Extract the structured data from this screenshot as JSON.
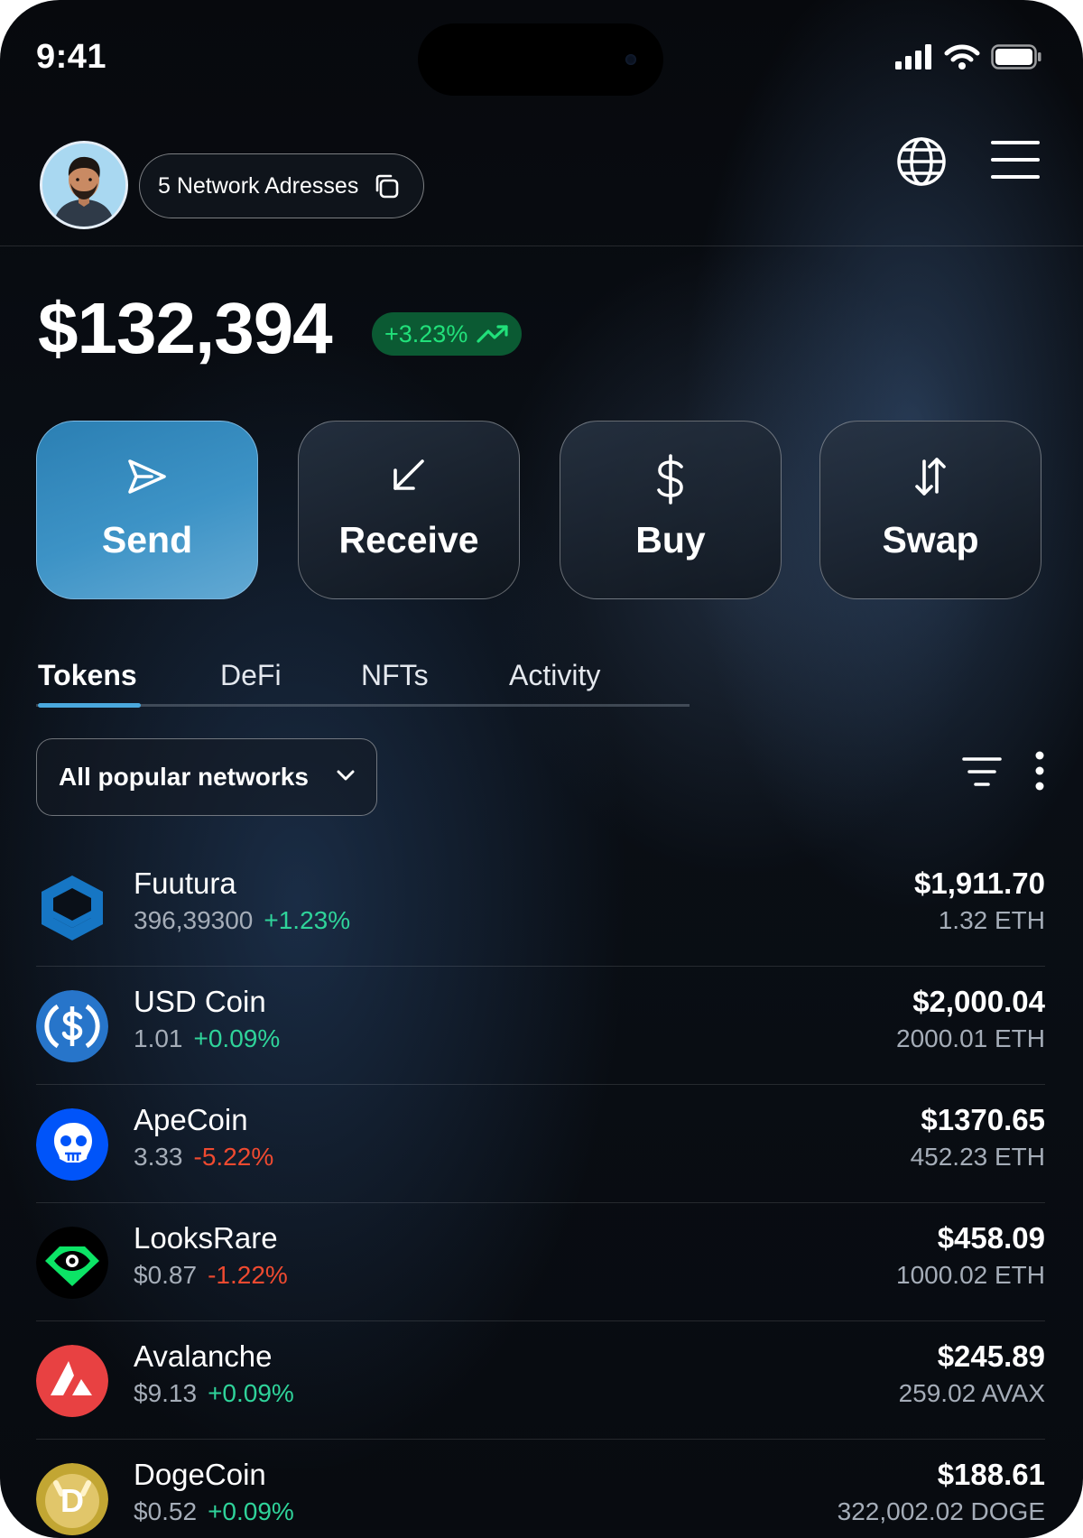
{
  "status_bar": {
    "time": "9:41"
  },
  "header": {
    "address_pill_label": "5 Network Adresses"
  },
  "balance": {
    "total": "$132,394",
    "change": "+3.23%"
  },
  "actions": [
    {
      "label": "Send",
      "icon": "send-icon"
    },
    {
      "label": "Receive",
      "icon": "arrow-down-left-icon"
    },
    {
      "label": "Buy",
      "icon": "dollar-icon"
    },
    {
      "label": "Swap",
      "icon": "swap-icon"
    }
  ],
  "tabs": [
    {
      "label": "Tokens",
      "active": true
    },
    {
      "label": "DeFi",
      "active": false
    },
    {
      "label": "NFTs",
      "active": false
    },
    {
      "label": "Activity",
      "active": false
    }
  ],
  "filter": {
    "network_select_value": "All popular networks"
  },
  "tokens": [
    {
      "name": "Fuutura",
      "price": "396,39300",
      "change": "+1.23%",
      "direction": "up",
      "value": "$1,911.70",
      "amount": "1.32 ETH",
      "icon": "fuutura-logo-icon",
      "color": "#1676c4"
    },
    {
      "name": "USD Coin",
      "price": "1.01",
      "change": "+0.09%",
      "direction": "up",
      "value": "$2,000.04",
      "amount": "2000.01 ETH",
      "icon": "usdc-logo-icon",
      "color": "#2775ca"
    },
    {
      "name": "ApeCoin",
      "price": "3.33",
      "change": "-5.22%",
      "direction": "down",
      "value": "$1370.65",
      "amount": "452.23 ETH",
      "icon": "apecoin-logo-icon",
      "color": "#0054f9"
    },
    {
      "name": "LooksRare",
      "price": "$0.87",
      "change": "-1.22%",
      "direction": "down",
      "value": "$458.09",
      "amount": "1000.02 ETH",
      "icon": "looksrare-logo-icon",
      "color": "#0ce466"
    },
    {
      "name": "Avalanche",
      "price": "$9.13",
      "change": "+0.09%",
      "direction": "up",
      "value": "$245.89",
      "amount": "259.02 AVAX",
      "icon": "avalanche-logo-icon",
      "color": "#e84142"
    },
    {
      "name": "DogeCoin",
      "price": "$0.52",
      "change": "+0.09%",
      "direction": "up",
      "value": "$188.61",
      "amount": "322,002.02 DOGE",
      "icon": "dogecoin-logo-icon",
      "color": "#c2a633"
    }
  ]
}
